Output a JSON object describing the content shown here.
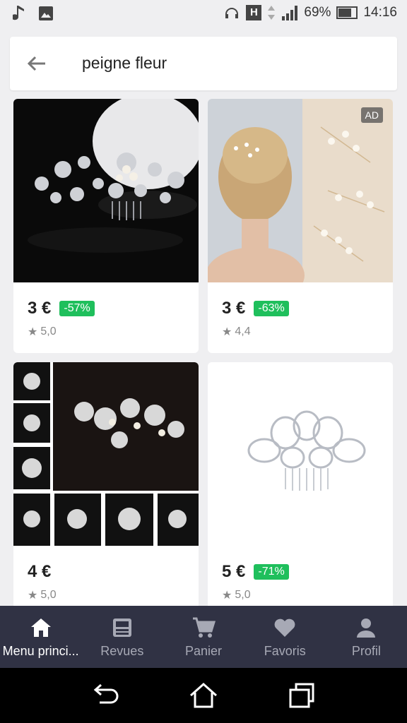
{
  "status_bar": {
    "battery": "69%",
    "time": "14:16",
    "h_label": "H"
  },
  "search": {
    "query": "peigne fleur"
  },
  "products": [
    {
      "price": "3 €",
      "discount": "-57%",
      "rating": "5,0",
      "ad": ""
    },
    {
      "price": "3 €",
      "discount": "-63%",
      "rating": "4,4",
      "ad": "AD"
    },
    {
      "price": "4 €",
      "discount": "",
      "rating": "5,0",
      "ad": ""
    },
    {
      "price": "5 €",
      "discount": "-71%",
      "rating": "5,0",
      "ad": ""
    }
  ],
  "bottom_nav": [
    {
      "label": "Menu princi...",
      "icon": "home-icon"
    },
    {
      "label": "Revues",
      "icon": "feed-icon"
    },
    {
      "label": "Panier",
      "icon": "cart-icon"
    },
    {
      "label": "Favoris",
      "icon": "heart-icon"
    },
    {
      "label": "Profil",
      "icon": "person-icon"
    }
  ],
  "colors": {
    "discount_green": "#1fbf5c",
    "nav_bg": "#303244",
    "nav_active": "#ffffff",
    "nav_inactive": "#a7a9b5"
  }
}
